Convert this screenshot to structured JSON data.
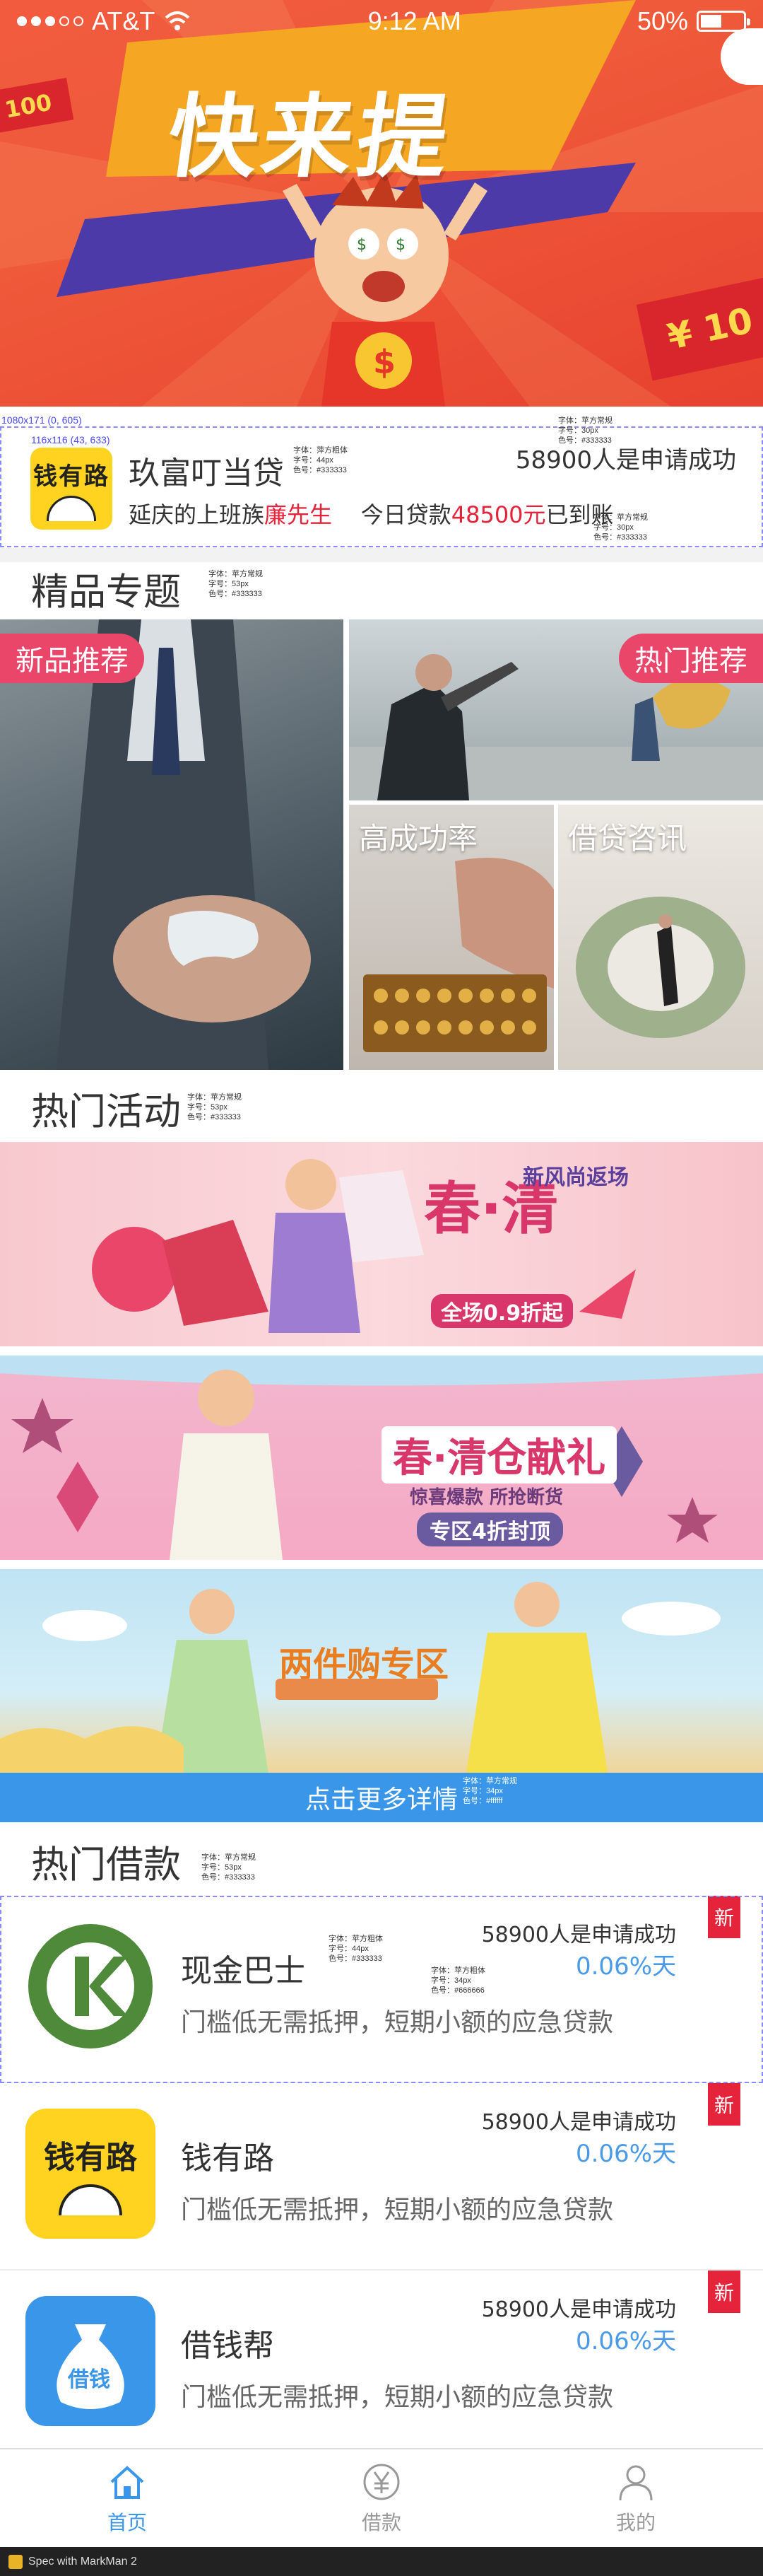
{
  "status": {
    "carrier": "AT&T",
    "time": "9:12 AM",
    "battery": "50%"
  },
  "hero": {
    "title": "快来提",
    "ribbon_left": "100",
    "ribbon_right": "¥ 10"
  },
  "promo": {
    "name": "玖富叮当贷",
    "count": "58900人是申请成功",
    "line_prefix": "延庆的上班族",
    "line_person": "廉先生",
    "line_mid": "今日贷款",
    "line_amount": "48500元",
    "line_suffix": "已到账",
    "logo_text": "钱有路"
  },
  "sections": {
    "featured": "精品专题",
    "activities": "热门活动",
    "loans": "热门借款"
  },
  "featured": {
    "new": "新品推荐",
    "hot": "热门推荐",
    "success": "高成功率",
    "consult": "借贷咨讯"
  },
  "banners": [
    {
      "title": "春·清",
      "subtitle": "新风尚返场",
      "deal": "全场0.9折起"
    },
    {
      "title": "春·清仓献礼",
      "subtitle": "惊喜爆款 所抢断货",
      "deal": "专区4折封顶"
    },
    {
      "title": "两件购专区",
      "subtitle": ""
    }
  ],
  "more_button": "点击更多详情",
  "loans": [
    {
      "name": "现金巴士",
      "count": "58900人是申请成功",
      "rate": "0.06%天",
      "desc": "门槛低无需抵押，短期小额的应急贷款",
      "badge": "新",
      "icon": "cash-bus"
    },
    {
      "name": "钱有路",
      "count": "58900人是申请成功",
      "rate": "0.06%天",
      "desc": "门槛低无需抵押，短期小额的应急贷款",
      "badge": "新",
      "icon": "money-road"
    },
    {
      "name": "借钱帮",
      "count": "58900人是申请成功",
      "rate": "0.06%天",
      "desc": "门槛低无需抵押，短期小额的应急贷款",
      "badge": "新",
      "icon": "borrow-help"
    }
  ],
  "tabs": [
    {
      "label": "首页",
      "icon": "home-icon",
      "active": true
    },
    {
      "label": "借款",
      "icon": "yen-icon",
      "active": false
    },
    {
      "label": "我的",
      "icon": "user-icon",
      "active": false
    }
  ],
  "footer": {
    "text": "Spec with MarkMan 2"
  },
  "colors": {
    "accent_blue": "#3a96e8",
    "accent_red": "#e5243b",
    "pink_tag": "#e9466a"
  }
}
